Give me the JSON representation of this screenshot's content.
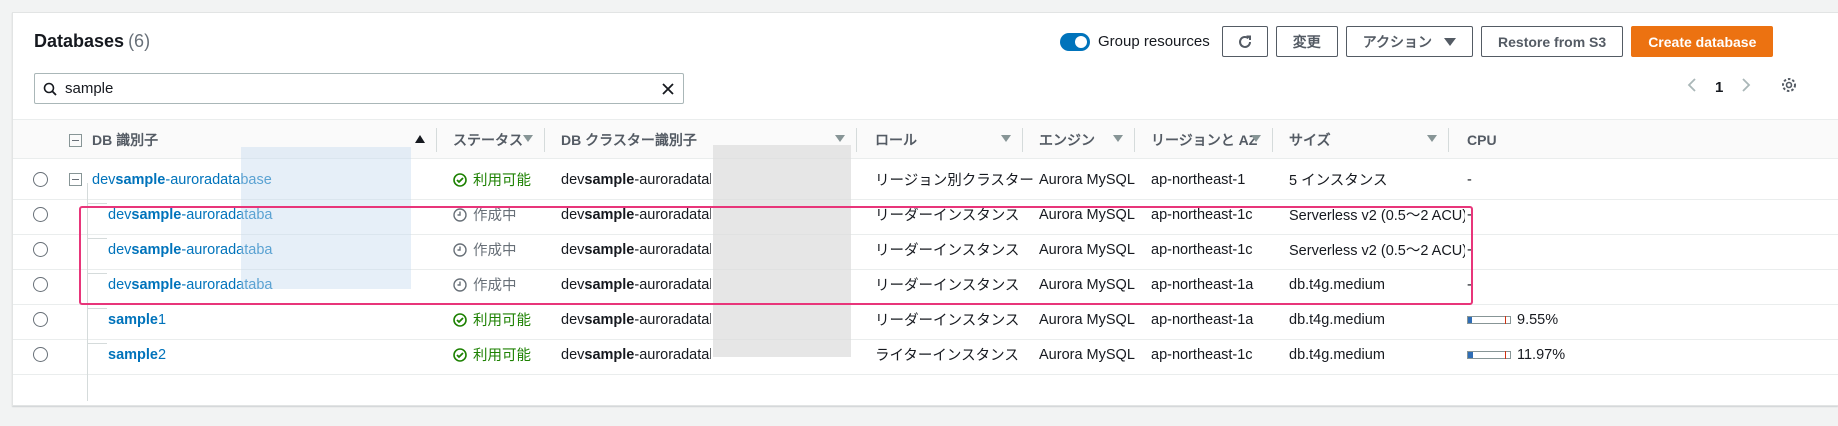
{
  "header": {
    "title": "Databases",
    "count": "(6)",
    "group_resources_label": "Group resources",
    "modify_label": "変更",
    "actions_label": "アクション",
    "restore_label": "Restore from S3",
    "create_label": "Create database"
  },
  "search": {
    "value": "sample"
  },
  "pager": {
    "page": "1"
  },
  "columns": [
    "DB 識別子",
    "ステータス",
    "DB クラスター識別子",
    "ロール",
    "エンジン",
    "リージョンと AZ",
    "サイズ",
    "CPU"
  ],
  "rows": [
    {
      "id_pre": "dev",
      "id_bold": "sample",
      "id_post": "-auroradatabase",
      "status": "利用可能",
      "status_type": "ok",
      "cluster_pre": "dev",
      "cluster_bold": "sample",
      "cluster_post": "-auroradatabase",
      "role": "リージョン別クラスター",
      "engine": "Aurora MySQL",
      "region": "ap-northeast-1",
      "size": "5 インスタンス",
      "cpu": "-"
    },
    {
      "id_pre": "dev",
      "id_bold": "sample",
      "id_post": "-auroradataba",
      "status": "作成中",
      "status_type": "wait",
      "cluster_pre": "dev",
      "cluster_bold": "sample",
      "cluster_post": "-auroradatabase",
      "role": "リーダーインスタンス",
      "engine": "Aurora MySQL",
      "region": "ap-northeast-1c",
      "size": "Serverless v2 (0.5～2 ACU)",
      "cpu": "-"
    },
    {
      "id_pre": "dev",
      "id_bold": "sample",
      "id_post": "-auroradataba",
      "status": "作成中",
      "status_type": "wait",
      "cluster_pre": "dev",
      "cluster_bold": "sample",
      "cluster_post": "-auroradatabase",
      "role": "リーダーインスタンス",
      "engine": "Aurora MySQL",
      "region": "ap-northeast-1c",
      "size": "Serverless v2 (0.5～2 ACU)",
      "cpu": "-"
    },
    {
      "id_pre": "dev",
      "id_bold": "sample",
      "id_post": "-auroradataba",
      "status": "作成中",
      "status_type": "wait",
      "cluster_pre": "dev",
      "cluster_bold": "sample",
      "cluster_post": "-auroradatabase",
      "role": "リーダーインスタンス",
      "engine": "Aurora MySQL",
      "region": "ap-northeast-1a",
      "size": "db.t4g.medium",
      "cpu": "-"
    },
    {
      "id_pre": "",
      "id_bold": "sample",
      "id_post": "1",
      "status": "利用可能",
      "status_type": "ok",
      "cluster_pre": "dev",
      "cluster_bold": "sample",
      "cluster_post": "-auroradatabase",
      "role": "リーダーインスタンス",
      "engine": "Aurora MySQL",
      "region": "ap-northeast-1a",
      "size": "db.t4g.medium",
      "cpu": "9.55%",
      "cpu_fraction": 0.0955
    },
    {
      "id_pre": "",
      "id_bold": "sample",
      "id_post": "2",
      "status": "利用可能",
      "status_type": "ok",
      "cluster_pre": "dev",
      "cluster_bold": "sample",
      "cluster_post": "-auroradatabase",
      "role": "ライターインスタンス",
      "engine": "Aurora MySQL",
      "region": "ap-northeast-1c",
      "size": "db.t4g.medium",
      "cpu": "11.97%",
      "cpu_fraction": 0.1197
    }
  ],
  "colors": {
    "accent": "#0073bb",
    "primary": "#ec7211",
    "ok": "#1d8102",
    "highlight": "#e8357a"
  }
}
